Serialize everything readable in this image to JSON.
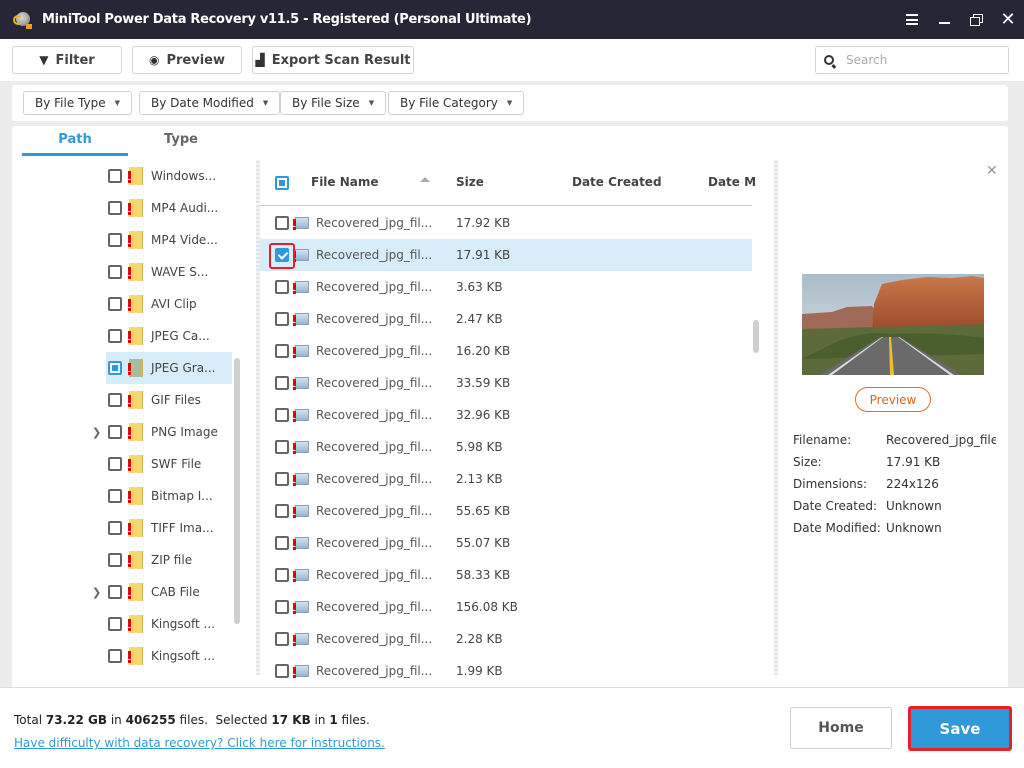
{
  "window": {
    "title": "MiniTool Power Data Recovery v11.5 - Registered (Personal Ultimate)",
    "controls": [
      "menu",
      "minimize",
      "restore",
      "close"
    ]
  },
  "toolbar": {
    "filter_label": "Filter",
    "preview_label": "Preview",
    "export_label": "Export Scan Result",
    "search_placeholder": "Search"
  },
  "filters": [
    {
      "label": "By File Type"
    },
    {
      "label": "By Date Modified"
    },
    {
      "label": "By File Size"
    },
    {
      "label": "By File Category"
    }
  ],
  "tabs": [
    {
      "label": "Path",
      "active": true
    },
    {
      "label": "Type",
      "active": false
    }
  ],
  "tree": [
    {
      "label": "Windows...",
      "state": "unchecked",
      "expandable": false
    },
    {
      "label": "MP4 Audi...",
      "state": "unchecked",
      "expandable": false
    },
    {
      "label": "MP4 Vide...",
      "state": "unchecked",
      "expandable": false
    },
    {
      "label": "WAVE S...",
      "state": "unchecked",
      "expandable": false
    },
    {
      "label": "AVI Clip",
      "state": "unchecked",
      "expandable": false
    },
    {
      "label": "JPEG Ca...",
      "state": "unchecked",
      "expandable": false
    },
    {
      "label": "JPEG Gra...",
      "state": "partial",
      "expandable": false,
      "selected": true
    },
    {
      "label": "GIF Files",
      "state": "unchecked",
      "expandable": false
    },
    {
      "label": "PNG Image",
      "state": "unchecked",
      "expandable": true
    },
    {
      "label": "SWF File",
      "state": "unchecked",
      "expandable": false
    },
    {
      "label": "Bitmap I...",
      "state": "unchecked",
      "expandable": false
    },
    {
      "label": "TIFF Ima...",
      "state": "unchecked",
      "expandable": false
    },
    {
      "label": "ZIP file",
      "state": "unchecked",
      "expandable": false
    },
    {
      "label": "CAB File",
      "state": "unchecked",
      "expandable": true
    },
    {
      "label": "Kingsoft ...",
      "state": "unchecked",
      "expandable": false
    },
    {
      "label": "Kingsoft ...",
      "state": "unchecked",
      "expandable": false
    }
  ],
  "file_list": {
    "columns": [
      "File Name",
      "Size",
      "Date Created",
      "Date M"
    ],
    "sort_column": "File Name",
    "sort_direction": "ascending",
    "rows": [
      {
        "name": "Recovered_jpg_fil...",
        "size": "17.92 KB",
        "checked": false
      },
      {
        "name": "Recovered_jpg_fil...",
        "size": "17.91 KB",
        "checked": true
      },
      {
        "name": "Recovered_jpg_fil...",
        "size": "3.63 KB",
        "checked": false
      },
      {
        "name": "Recovered_jpg_fil...",
        "size": "2.47 KB",
        "checked": false
      },
      {
        "name": "Recovered_jpg_fil...",
        "size": "16.20 KB",
        "checked": false
      },
      {
        "name": "Recovered_jpg_fil...",
        "size": "33.59 KB",
        "checked": false
      },
      {
        "name": "Recovered_jpg_fil...",
        "size": "32.96 KB",
        "checked": false
      },
      {
        "name": "Recovered_jpg_fil...",
        "size": "5.98 KB",
        "checked": false
      },
      {
        "name": "Recovered_jpg_fil...",
        "size": "2.13 KB",
        "checked": false
      },
      {
        "name": "Recovered_jpg_fil...",
        "size": "55.65 KB",
        "checked": false
      },
      {
        "name": "Recovered_jpg_fil...",
        "size": "55.07 KB",
        "checked": false
      },
      {
        "name": "Recovered_jpg_fil...",
        "size": "58.33 KB",
        "checked": false
      },
      {
        "name": "Recovered_jpg_fil...",
        "size": "156.08 KB",
        "checked": false
      },
      {
        "name": "Recovered_jpg_fil...",
        "size": "2.28 KB",
        "checked": false
      },
      {
        "name": "Recovered_jpg_fil...",
        "size": "1.99 KB",
        "checked": false
      }
    ]
  },
  "preview": {
    "button_label": "Preview",
    "meta": [
      {
        "label": "Filename:",
        "value": "Recovered_jpg_file("
      },
      {
        "label": "Size:",
        "value": "17.91 KB"
      },
      {
        "label": "Dimensions:",
        "value": "224x126"
      },
      {
        "label": "Date Created:",
        "value": "Unknown"
      },
      {
        "label": "Date Modified:",
        "value": "Unknown"
      }
    ]
  },
  "footer": {
    "total_prefix": "Total",
    "total_size": "73.22 GB",
    "in_1": "in",
    "total_files": "406255",
    "files_1": "files.",
    "selected_prefix": "Selected",
    "selected_size": "17 KB",
    "in_2": "in",
    "selected_files": "1",
    "files_2": "files.",
    "help_link": "Have difficulty with data recovery? Click here for instructions.",
    "home_label": "Home",
    "save_label": "Save"
  },
  "colors": {
    "accent": "#2f9ad7",
    "titlebar": "#272636",
    "highlight_outline": "#e8202a",
    "preview_button": "#e07020"
  }
}
